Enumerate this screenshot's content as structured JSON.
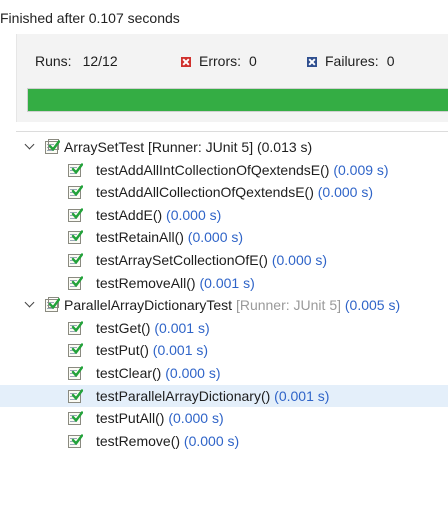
{
  "status_text": "Finished after 0.107 seconds",
  "counters": {
    "runs_label": "Runs:",
    "runs_value": "12/12",
    "errors_label": "Errors:",
    "errors_value": "0",
    "failures_label": "Failures:",
    "failures_value": "0"
  },
  "progress": {
    "fraction": 1.0,
    "color": "#34ad44"
  },
  "colors": {
    "time": "#2f64c8",
    "runner_dim": "#9a9a9a",
    "selected_row": "#e4effa"
  },
  "tree": [
    {
      "name": "ArraySetTest",
      "runner": " [Runner: JUnit 5]",
      "time": " (0.013 s)",
      "runner_dimmed": false,
      "expanded": true,
      "icon": "test-suite-icon",
      "tests": [
        {
          "name": "testAddAllIntCollectionOfQextendsE()",
          "time": " (0.009 s)",
          "icon": "test-passed-icon"
        },
        {
          "name": "testAddAllCollectionOfQextendsE()",
          "time": " (0.000 s)",
          "icon": "test-passed-icon"
        },
        {
          "name": "testAddE()",
          "time": " (0.000 s)",
          "icon": "test-passed-icon"
        },
        {
          "name": "testRetainAll()",
          "time": " (0.000 s)",
          "icon": "test-passed-icon"
        },
        {
          "name": "testArraySetCollectionOfE()",
          "time": " (0.000 s)",
          "icon": "test-passed-icon"
        },
        {
          "name": "testRemoveAll()",
          "time": " (0.001 s)",
          "icon": "test-passed-icon"
        }
      ]
    },
    {
      "name": "ParallelArrayDictionaryTest",
      "runner": " [Runner: JUnit 5]",
      "time": " (0.005 s)",
      "runner_dimmed": true,
      "expanded": true,
      "icon": "test-suite-icon",
      "tests": [
        {
          "name": "testGet()",
          "time": " (0.001 s)",
          "icon": "test-passed-icon"
        },
        {
          "name": "testPut()",
          "time": " (0.001 s)",
          "icon": "test-passed-icon"
        },
        {
          "name": "testClear()",
          "time": " (0.000 s)",
          "icon": "test-passed-icon"
        },
        {
          "name": "testParallelArrayDictionary()",
          "time": " (0.001 s)",
          "icon": "test-passed-icon",
          "selected": true
        },
        {
          "name": "testPutAll()",
          "time": " (0.000 s)",
          "icon": "test-passed-icon"
        },
        {
          "name": "testRemove()",
          "time": " (0.000 s)",
          "icon": "test-passed-icon"
        }
      ]
    }
  ]
}
